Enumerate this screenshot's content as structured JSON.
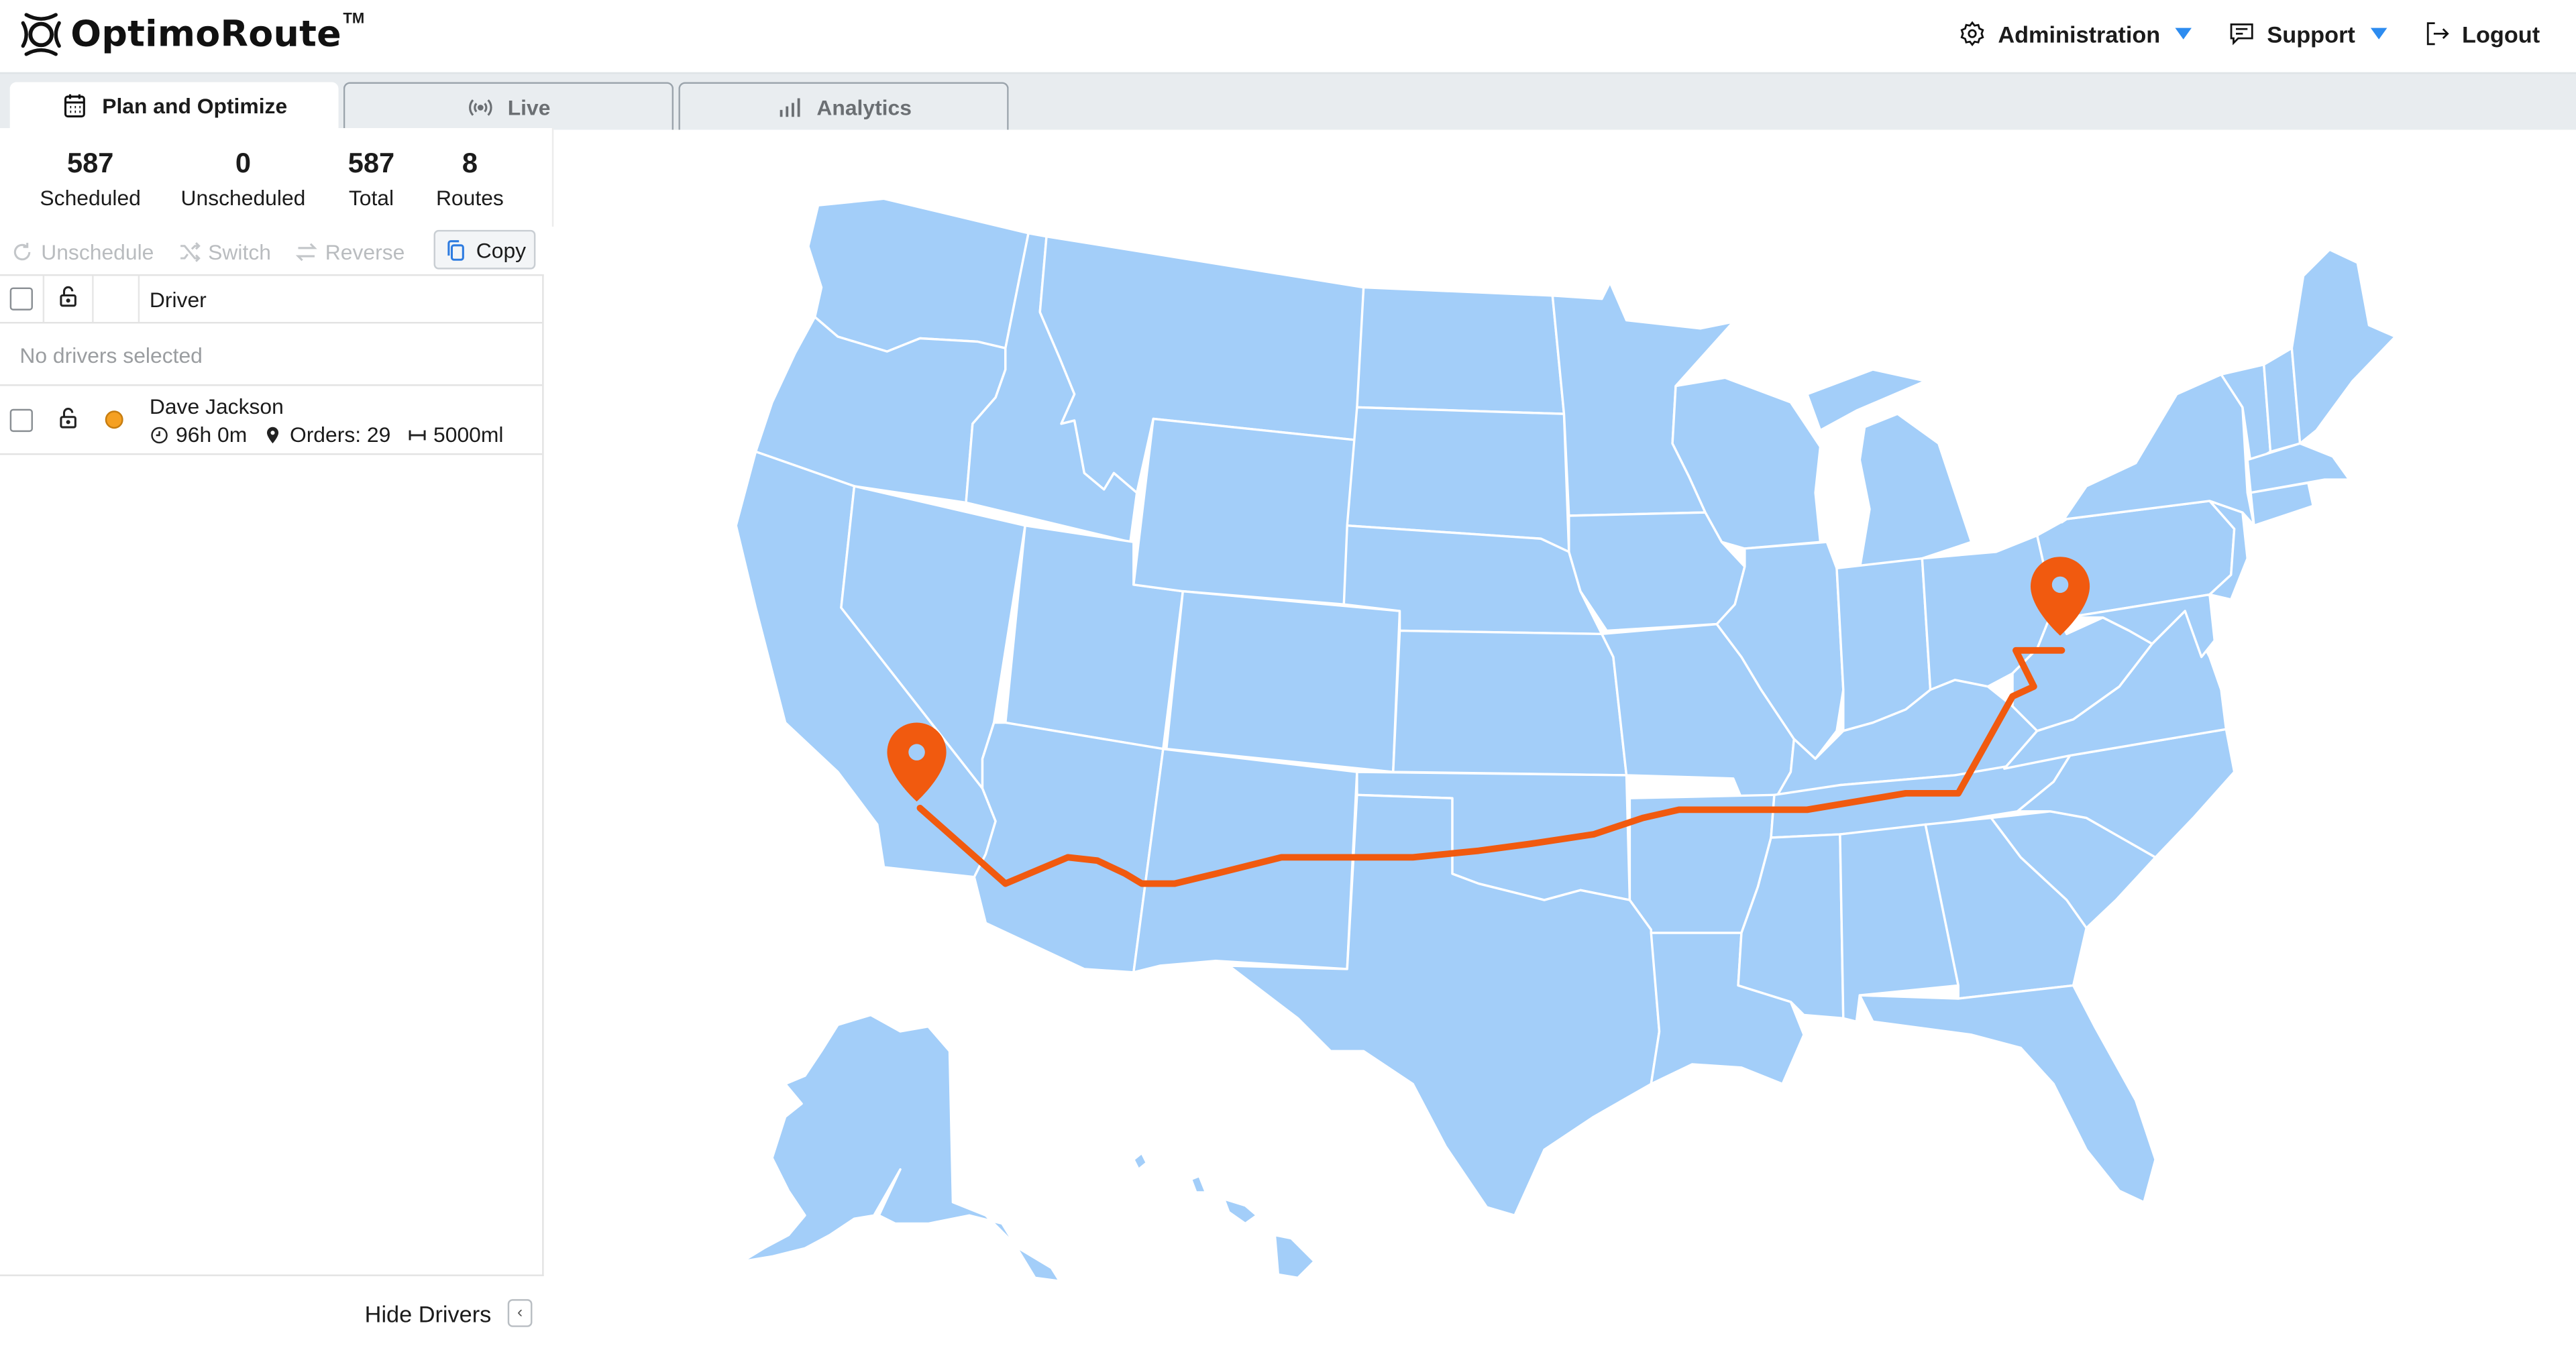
{
  "app": {
    "name": "OptimoRoute",
    "trademark": "TM"
  },
  "header": {
    "nav": [
      {
        "label": "Administration",
        "icon": "gear-icon",
        "dropdown": true
      },
      {
        "label": "Support",
        "icon": "chat-icon",
        "dropdown": true
      },
      {
        "label": "Logout",
        "icon": "logout-icon",
        "dropdown": false
      }
    ],
    "accent_color": "#2d8cf0"
  },
  "tabs": [
    {
      "label": "Plan and Optimize",
      "icon": "calendar-icon",
      "active": true
    },
    {
      "label": "Live",
      "icon": "broadcast-icon",
      "active": false
    },
    {
      "label": "Analytics",
      "icon": "bar-chart-icon",
      "active": false
    }
  ],
  "stats": [
    {
      "value": "587",
      "label": "Scheduled"
    },
    {
      "value": "0",
      "label": "Unscheduled"
    },
    {
      "value": "587",
      "label": "Total"
    },
    {
      "value": "8",
      "label": "Routes"
    }
  ],
  "toolbar": {
    "unschedule": "Unschedule",
    "switch": "Switch",
    "reverse": "Reverse",
    "copy": "Copy"
  },
  "drivers_table": {
    "header_driver": "Driver",
    "empty_selection": "No drivers selected",
    "rows": [
      {
        "name": "Dave Jackson",
        "duration": "96h 0m",
        "orders": "Orders: 29",
        "distance": "5000ml",
        "color": "#f5a022"
      }
    ]
  },
  "footer": {
    "hide_drivers": "Hide Drivers"
  },
  "map": {
    "land_color": "#a3cef9",
    "route_color": "#f15a0f",
    "pins": [
      {
        "name": "start-pin",
        "location": "Southern California"
      },
      {
        "name": "end-pin",
        "location": "Ohio / West Virginia"
      }
    ]
  }
}
